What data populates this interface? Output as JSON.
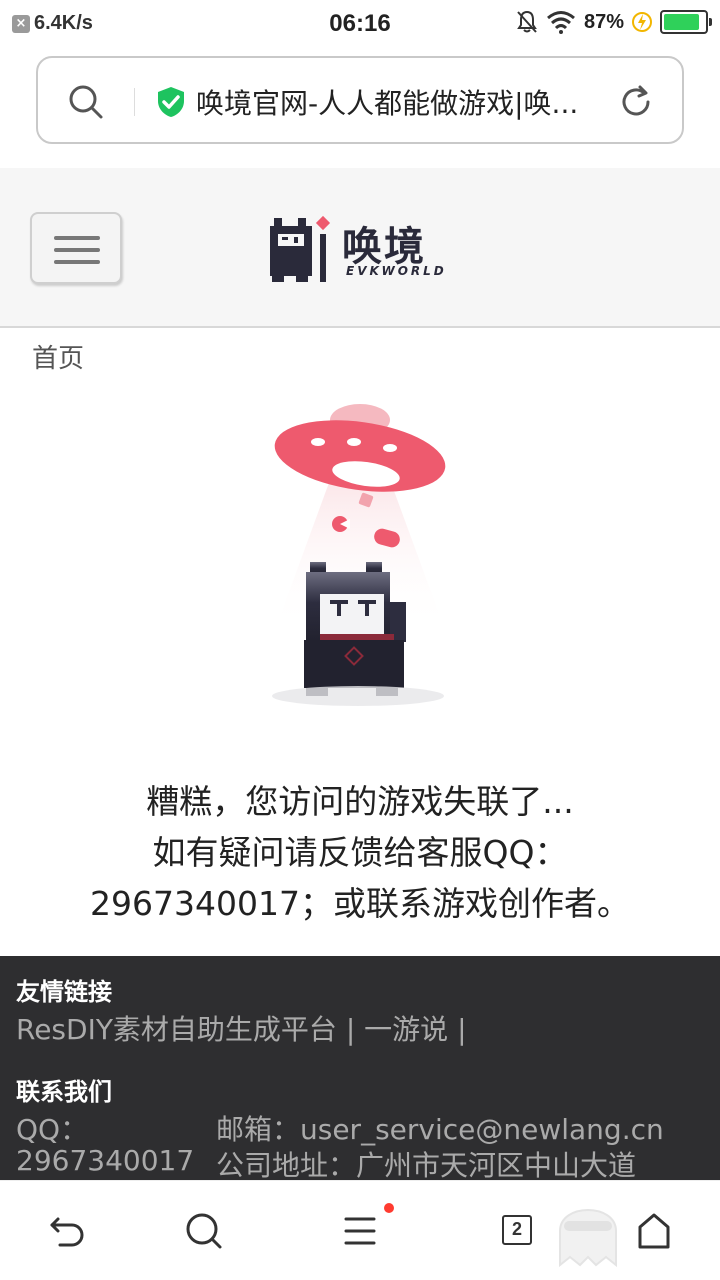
{
  "status_bar": {
    "net_speed": "6.4K/s",
    "time": "06:16",
    "battery_percent": "87%",
    "battery_level": 0.87,
    "battery_color": "#2fd15a"
  },
  "url_bar": {
    "page_title": "唤境官网-人人都能做游戏|唤...",
    "secure": true,
    "secure_color": "#1ec35f"
  },
  "site_header": {
    "logo_text": "唤境",
    "logo_subtext": "EVKWORLD"
  },
  "breadcrumb": "首页",
  "message": {
    "line1": "糟糕，您访问的游戏失联了...",
    "line2": "如有疑问请反馈给客服QQ：",
    "line3": "2967340017；或联系游戏创作者。"
  },
  "footer": {
    "links_title": "友情链接",
    "links_text": "ResDIY素材自助生成平台 | 一游说 |",
    "contact_title": "联系我们",
    "qq_label": "QQ：",
    "qq_value": "2967340017",
    "email_text": "邮箱：user_service@newlang.cn",
    "address_text": "公司地址：广州市天河区中山大道"
  },
  "bottom_nav": {
    "tab_count": "2",
    "icons": [
      "back-icon",
      "search-icon",
      "menu-icon",
      "tabs-icon",
      "incognito-icon",
      "home-icon"
    ]
  },
  "colors": {
    "ufo": "#ee5a6e",
    "footer_bg": "#2e2e30",
    "notification_dot": "#ff3b30"
  }
}
